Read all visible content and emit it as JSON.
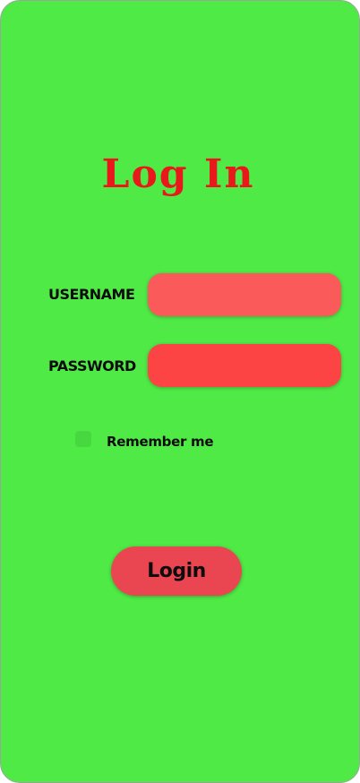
{
  "page": {
    "title": "Log In"
  },
  "form": {
    "username_label": "USERNAME",
    "password_label": "PASSWORD",
    "username_value": "",
    "password_value": "",
    "remember_label": "Remember me",
    "remember_checked": false,
    "login_label": "Login"
  },
  "colors": {
    "background": "#50ea47",
    "title": "#e8181b",
    "username_field": "#fa5a5a",
    "password_field": "#fd4444",
    "login_button": "#ea4651",
    "checkbox": "#47d840"
  }
}
